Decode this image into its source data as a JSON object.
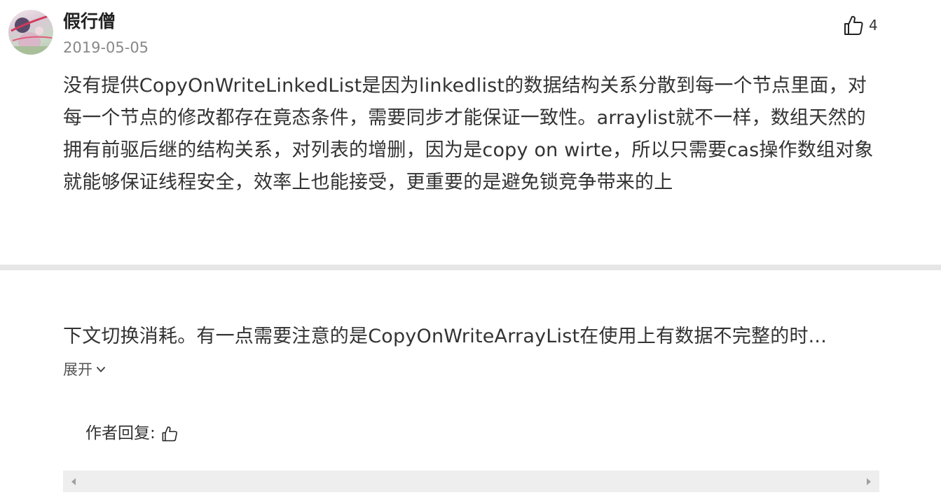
{
  "comment": {
    "author": "假行僧",
    "date": "2019-05-05",
    "likes": "4",
    "text_top": "没有提供CopyOnWriteLinkedList是因为linkedlist的数据结构关系分散到每一个节点里面，对每一个节点的修改都存在竟态条件，需要同步才能保证一致性。arraylist就不一样，数组天然的拥有前驱后继的结构关系，对列表的增删，因为是copy on wirte，所以只需要cas操作数组对象就能够保证线程安全，效率上也能接受，更重要的是避免锁竞争带来的上",
    "text_bottom": "下文切换消耗。有一点需要注意的是CopyOnWriteArrayList在使用上有数据不完整的时...",
    "expand_label": "展开",
    "author_reply_label": "作者回复:"
  },
  "icons": {
    "avatar": "avatar-image",
    "like": "thumbs-up-icon",
    "expand": "chevron-down-icon",
    "reply_like": "thumbs-up-icon",
    "scroll_left": "triangle-left-icon",
    "scroll_right": "triangle-right-icon"
  },
  "colors": {
    "text": "#333333",
    "muted": "#888888",
    "divider": "#e6e6e6",
    "scrollbar": "#eeeeee"
  }
}
